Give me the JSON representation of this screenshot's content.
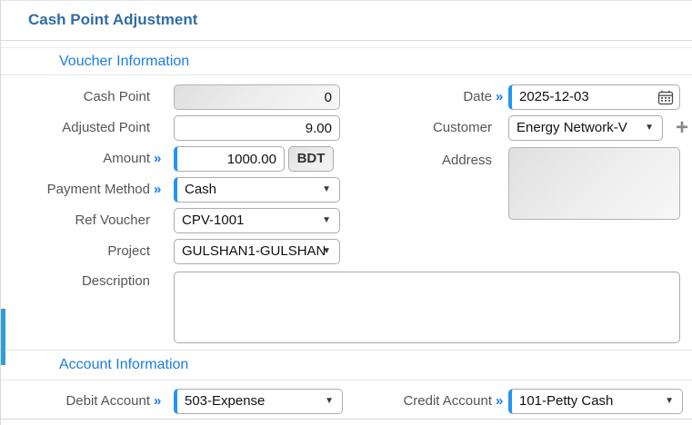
{
  "header": {
    "title": "Cash Point Adjustment"
  },
  "colors": {
    "page_title": "#2e6da4",
    "section_title": "#1a7ce8",
    "focus_border": "#2196f3",
    "required_marker": "#1a7ce8",
    "left_strip": "#2e9fd4",
    "disabled_field_bg": "#e8e8e8"
  },
  "icons": {
    "required_marker": "»",
    "dropdown_caret": "▼",
    "calendar": "calendar-icon",
    "add_customer": "+"
  },
  "voucher_section": {
    "title": "Voucher Information",
    "cash_point": {
      "label": "Cash Point",
      "value": "0",
      "disabled": true
    },
    "adjusted_point": {
      "label": "Adjusted Point",
      "value": "9.00"
    },
    "amount": {
      "label": "Amount",
      "value": "1000.00",
      "currency_label": "BDT",
      "required": true
    },
    "payment_method": {
      "label": "Payment Method",
      "value": "Cash",
      "required": true
    },
    "ref_voucher": {
      "label": "Ref Voucher",
      "value": "CPV-1001"
    },
    "project": {
      "label": "Project",
      "value": "GULSHAN1-GULSHAN"
    },
    "description": {
      "label": "Description",
      "value": ""
    },
    "date": {
      "label": "Date",
      "value": "2025-12-03",
      "required": true
    },
    "customer": {
      "label": "Customer",
      "value": "Energy Network-V"
    },
    "address": {
      "label": "Address",
      "value": "",
      "disabled": true
    }
  },
  "account_section": {
    "title": "Account Information",
    "debit_account": {
      "label": "Debit Account",
      "value": "503-Expense",
      "required": true
    },
    "credit_account": {
      "label": "Credit Account",
      "value": "101-Petty Cash",
      "required": true
    }
  }
}
